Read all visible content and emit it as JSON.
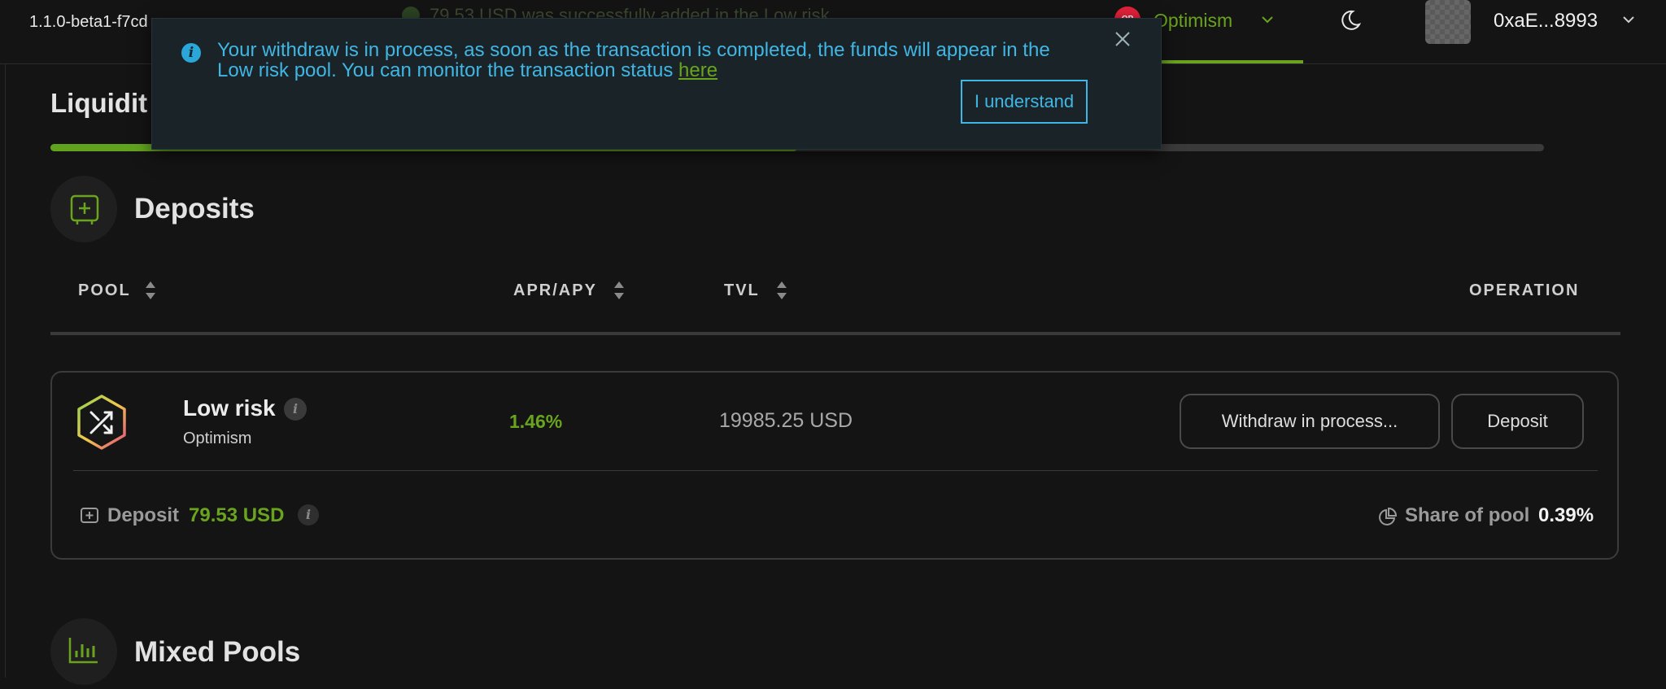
{
  "header": {
    "version": "1.1.0-beta1-f7cd",
    "background_message": "79.53 USD was successfully added in the Low risk",
    "network": {
      "label": "Optimism",
      "icon": "OP"
    },
    "theme_icon": "moon-icon",
    "wallet": "0xaE...8993"
  },
  "page": {
    "title": "Liquidit",
    "progress_fraction": 0.5
  },
  "toast": {
    "message": "Your withdraw is in process, as soon as the transaction is completed, the funds will appear in the Low risk pool. You can monitor the transaction status ",
    "link": "here",
    "button": "I understand",
    "close_icon": "close-icon"
  },
  "deposits": {
    "title": "Deposits",
    "columns": {
      "pool": "POOL",
      "apr": "APR/APY",
      "tvl": "TVL",
      "operation": "OPERATION"
    },
    "pool": {
      "name": "Low risk",
      "network": "Optimism",
      "apr": "1.46%",
      "tvl": "19985.25 USD",
      "withdraw_button": "Withdraw in process...",
      "deposit_button": "Deposit",
      "deposit_label": "Deposit",
      "deposit_value": "79.53 USD",
      "share_label": "Share of pool",
      "share_value": "0.39%"
    }
  },
  "mixed": {
    "title": "Mixed Pools"
  },
  "colors": {
    "accent": "#6aa41f",
    "info": "#40b6e4",
    "background": "#141414"
  }
}
